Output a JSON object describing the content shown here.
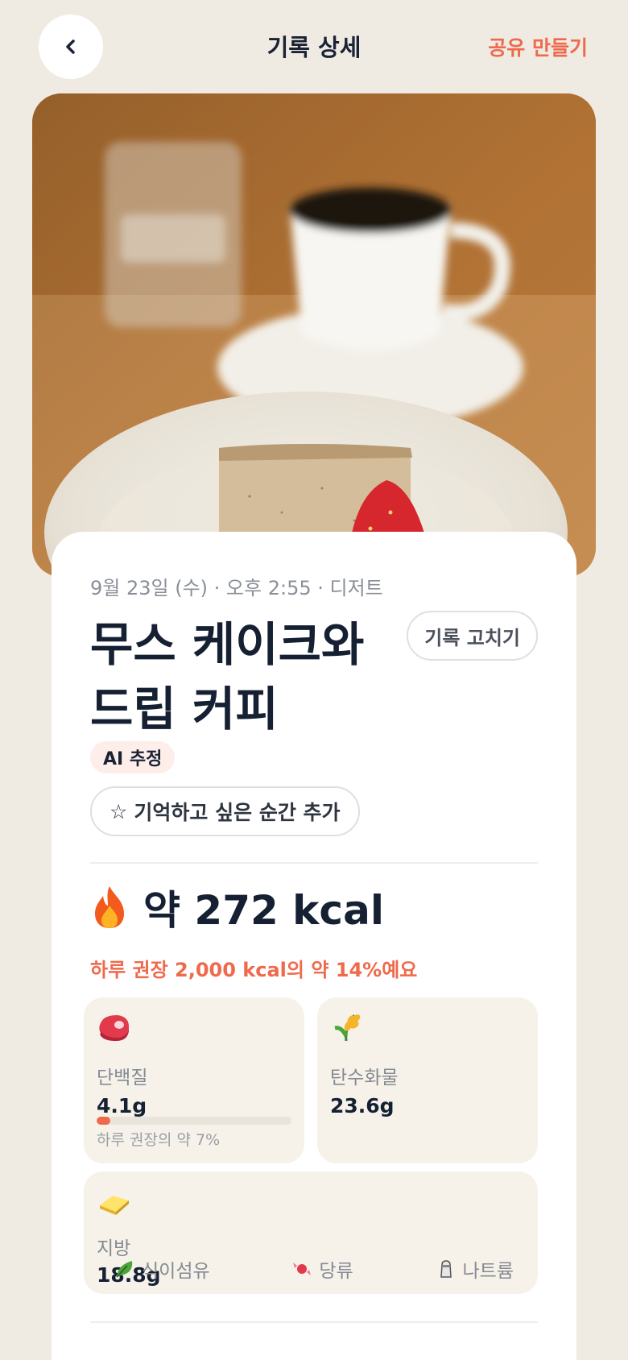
{
  "header": {
    "title": "기록 상세",
    "share_label": "공유 만들기"
  },
  "entry": {
    "meta": "9월 23일 (수) · 오후 2:55 · 디저트",
    "title": "무스 케이크와 드립 커피",
    "edit_label": "기록 고치기",
    "ai_badge": "AI 추정",
    "memory_label": "기억하고 싶은 순간 추가"
  },
  "calories": {
    "value_text": "약 272 kcal",
    "subtitle": "하루 권장 2,000 kcal의 약 14%예요"
  },
  "nutrients": [
    {
      "name": "단백질",
      "value": "4.1g",
      "icon": "meat-icon",
      "note": "하루 권장의 약 7%",
      "percent": 7
    },
    {
      "name": "탄수화물",
      "value": "23.6g",
      "icon": "rice-icon"
    },
    {
      "name": "지방",
      "value": "18.8g",
      "icon": "butter-icon"
    }
  ],
  "more_nutrients": [
    {
      "name": "식이섬유",
      "icon": "leaf-icon"
    },
    {
      "name": "당류",
      "icon": "candy-icon"
    },
    {
      "name": "나트륨",
      "icon": "salt-shaker-icon"
    }
  ],
  "colors": {
    "accent": "#ef6a4c",
    "background": "#efebe3",
    "card": "#ffffff",
    "nutrient_card": "#f6f2ea",
    "text": "#1a2233"
  }
}
